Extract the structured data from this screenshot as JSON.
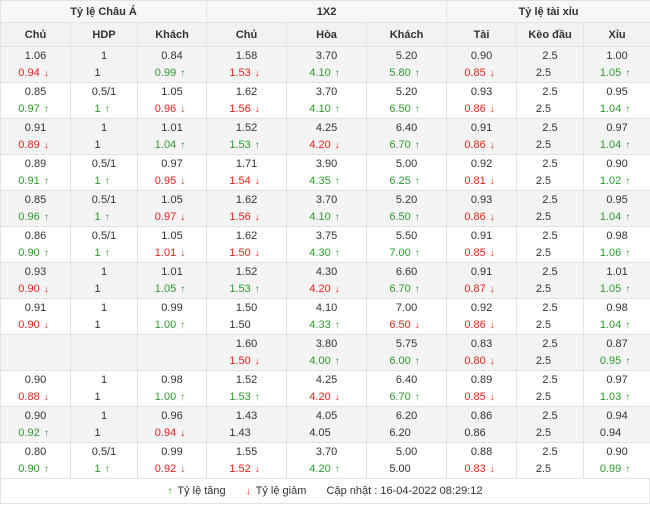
{
  "groups": [
    "Tỷ lệ Châu Á",
    "1X2",
    "Tỷ lệ tài xỉu"
  ],
  "columns": [
    "Chủ",
    "HDP",
    "Khách",
    "Chủ",
    "Hòa",
    "Khách",
    "Tài",
    "Kèo đầu",
    "Xỉu"
  ],
  "colors": {
    "up": "#2d9a2d",
    "down": "#e2231a",
    "header_bg": "#f2f2f2",
    "border": "#e3e3e3"
  },
  "rows": [
    {
      "cells": [
        {
          "top": "1.06",
          "bot": "0.94",
          "dir": "down"
        },
        {
          "top": "1",
          "bot": "1",
          "dir": ""
        },
        {
          "top": "0.84",
          "bot": "0.99",
          "dir": "up"
        },
        {
          "top": "1.58",
          "bot": "1.53",
          "dir": "down"
        },
        {
          "top": "3.70",
          "bot": "4.10",
          "dir": "up"
        },
        {
          "top": "5.20",
          "bot": "5.80",
          "dir": "up"
        },
        {
          "top": "0.90",
          "bot": "0.85",
          "dir": "down"
        },
        {
          "top": "2.5",
          "bot": "2.5",
          "dir": ""
        },
        {
          "top": "1.00",
          "bot": "1.05",
          "dir": "up"
        }
      ]
    },
    {
      "cells": [
        {
          "top": "0.85",
          "bot": "0.97",
          "dir": "up"
        },
        {
          "top": "0.5/1",
          "bot": "1",
          "dir": "up"
        },
        {
          "top": "1.05",
          "bot": "0.96",
          "dir": "down"
        },
        {
          "top": "1.62",
          "bot": "1.56",
          "dir": "down"
        },
        {
          "top": "3.70",
          "bot": "4.10",
          "dir": "up"
        },
        {
          "top": "5.20",
          "bot": "6.50",
          "dir": "up"
        },
        {
          "top": "0.93",
          "bot": "0.86",
          "dir": "down"
        },
        {
          "top": "2.5",
          "bot": "2.5",
          "dir": ""
        },
        {
          "top": "0.95",
          "bot": "1.04",
          "dir": "up"
        }
      ]
    },
    {
      "cells": [
        {
          "top": "0.91",
          "bot": "0.89",
          "dir": "down"
        },
        {
          "top": "1",
          "bot": "1",
          "dir": ""
        },
        {
          "top": "1.01",
          "bot": "1.04",
          "dir": "up"
        },
        {
          "top": "1.52",
          "bot": "1.53",
          "dir": "up"
        },
        {
          "top": "4.25",
          "bot": "4.20",
          "dir": "down"
        },
        {
          "top": "6.40",
          "bot": "6.70",
          "dir": "up"
        },
        {
          "top": "0.91",
          "bot": "0.86",
          "dir": "down"
        },
        {
          "top": "2.5",
          "bot": "2.5",
          "dir": ""
        },
        {
          "top": "0.97",
          "bot": "1.04",
          "dir": "up"
        }
      ]
    },
    {
      "cells": [
        {
          "top": "0.89",
          "bot": "0.91",
          "dir": "up"
        },
        {
          "top": "0.5/1",
          "bot": "1",
          "dir": "up"
        },
        {
          "top": "0.97",
          "bot": "0.95",
          "dir": "down"
        },
        {
          "top": "1.71",
          "bot": "1.54",
          "dir": "down"
        },
        {
          "top": "3.90",
          "bot": "4.35",
          "dir": "up"
        },
        {
          "top": "5.00",
          "bot": "6.25",
          "dir": "up"
        },
        {
          "top": "0.92",
          "bot": "0.81",
          "dir": "down"
        },
        {
          "top": "2.5",
          "bot": "2.5",
          "dir": ""
        },
        {
          "top": "0.90",
          "bot": "1.02",
          "dir": "up"
        }
      ]
    },
    {
      "cells": [
        {
          "top": "0.85",
          "bot": "0.96",
          "dir": "up"
        },
        {
          "top": "0.5/1",
          "bot": "1",
          "dir": "up"
        },
        {
          "top": "1.05",
          "bot": "0.97",
          "dir": "down"
        },
        {
          "top": "1.62",
          "bot": "1.56",
          "dir": "down"
        },
        {
          "top": "3.70",
          "bot": "4.10",
          "dir": "up"
        },
        {
          "top": "5.20",
          "bot": "6.50",
          "dir": "up"
        },
        {
          "top": "0.93",
          "bot": "0.86",
          "dir": "down"
        },
        {
          "top": "2.5",
          "bot": "2.5",
          "dir": ""
        },
        {
          "top": "0.95",
          "bot": "1.04",
          "dir": "up"
        }
      ]
    },
    {
      "cells": [
        {
          "top": "0.86",
          "bot": "0.90",
          "dir": "up"
        },
        {
          "top": "0.5/1",
          "bot": "1",
          "dir": "up"
        },
        {
          "top": "1.05",
          "bot": "1.01",
          "dir": "down"
        },
        {
          "top": "1.62",
          "bot": "1.50",
          "dir": "down"
        },
        {
          "top": "3.75",
          "bot": "4.30",
          "dir": "up"
        },
        {
          "top": "5.50",
          "bot": "7.00",
          "dir": "up"
        },
        {
          "top": "0.91",
          "bot": "0.85",
          "dir": "down"
        },
        {
          "top": "2.5",
          "bot": "2.5",
          "dir": ""
        },
        {
          "top": "0.98",
          "bot": "1.06",
          "dir": "up"
        }
      ]
    },
    {
      "cells": [
        {
          "top": "0.93",
          "bot": "0.90",
          "dir": "down"
        },
        {
          "top": "1",
          "bot": "1",
          "dir": ""
        },
        {
          "top": "1.01",
          "bot": "1.05",
          "dir": "up"
        },
        {
          "top": "1.52",
          "bot": "1.53",
          "dir": "up"
        },
        {
          "top": "4.30",
          "bot": "4.20",
          "dir": "down"
        },
        {
          "top": "6.60",
          "bot": "6.70",
          "dir": "up"
        },
        {
          "top": "0.91",
          "bot": "0.87",
          "dir": "down"
        },
        {
          "top": "2.5",
          "bot": "2.5",
          "dir": ""
        },
        {
          "top": "1.01",
          "bot": "1.05",
          "dir": "up"
        }
      ]
    },
    {
      "cells": [
        {
          "top": "0.91",
          "bot": "0.90",
          "dir": "down"
        },
        {
          "top": "1",
          "bot": "1",
          "dir": ""
        },
        {
          "top": "0.99",
          "bot": "1.00",
          "dir": "up"
        },
        {
          "top": "1.50",
          "bot": "1.50",
          "dir": ""
        },
        {
          "top": "4.10",
          "bot": "4.33",
          "dir": "up"
        },
        {
          "top": "7.00",
          "bot": "6.50",
          "dir": "down"
        },
        {
          "top": "0.92",
          "bot": "0.86",
          "dir": "down"
        },
        {
          "top": "2.5",
          "bot": "2.5",
          "dir": ""
        },
        {
          "top": "0.98",
          "bot": "1.04",
          "dir": "up"
        }
      ]
    },
    {
      "cells": [
        {
          "top": "",
          "bot": "",
          "dir": ""
        },
        {
          "top": "",
          "bot": "",
          "dir": ""
        },
        {
          "top": "",
          "bot": "",
          "dir": ""
        },
        {
          "top": "1.60",
          "bot": "1.50",
          "dir": "down"
        },
        {
          "top": "3.80",
          "bot": "4.00",
          "dir": "up"
        },
        {
          "top": "5.75",
          "bot": "6.00",
          "dir": "up"
        },
        {
          "top": "0.83",
          "bot": "0.80",
          "dir": "down"
        },
        {
          "top": "2.5",
          "bot": "2.5",
          "dir": ""
        },
        {
          "top": "0.87",
          "bot": "0.95",
          "dir": "up"
        }
      ]
    },
    {
      "cells": [
        {
          "top": "0.90",
          "bot": "0.88",
          "dir": "down"
        },
        {
          "top": "1",
          "bot": "1",
          "dir": ""
        },
        {
          "top": "0.98",
          "bot": "1.00",
          "dir": "up"
        },
        {
          "top": "1.52",
          "bot": "1.53",
          "dir": "up"
        },
        {
          "top": "4.25",
          "bot": "4.20",
          "dir": "down"
        },
        {
          "top": "6.40",
          "bot": "6.70",
          "dir": "up"
        },
        {
          "top": "0.89",
          "bot": "0.85",
          "dir": "down"
        },
        {
          "top": "2.5",
          "bot": "2.5",
          "dir": ""
        },
        {
          "top": "0.97",
          "bot": "1.03",
          "dir": "up"
        }
      ]
    },
    {
      "cells": [
        {
          "top": "0.90",
          "bot": "0.92",
          "dir": "up"
        },
        {
          "top": "1",
          "bot": "1",
          "dir": ""
        },
        {
          "top": "0.96",
          "bot": "0.94",
          "dir": "down"
        },
        {
          "top": "1.43",
          "bot": "1.43",
          "dir": ""
        },
        {
          "top": "4.05",
          "bot": "4.05",
          "dir": ""
        },
        {
          "top": "6.20",
          "bot": "6.20",
          "dir": ""
        },
        {
          "top": "0.86",
          "bot": "0.86",
          "dir": ""
        },
        {
          "top": "2.5",
          "bot": "2.5",
          "dir": ""
        },
        {
          "top": "0.94",
          "bot": "0.94",
          "dir": ""
        }
      ]
    },
    {
      "cells": [
        {
          "top": "0.80",
          "bot": "0.90",
          "dir": "up"
        },
        {
          "top": "0.5/1",
          "bot": "1",
          "dir": "up"
        },
        {
          "top": "0.99",
          "bot": "0.92",
          "dir": "down"
        },
        {
          "top": "1.55",
          "bot": "1.52",
          "dir": "down"
        },
        {
          "top": "3.70",
          "bot": "4.20",
          "dir": "up"
        },
        {
          "top": "5.00",
          "bot": "5.00",
          "dir": ""
        },
        {
          "top": "0.88",
          "bot": "0.83",
          "dir": "down"
        },
        {
          "top": "2.5",
          "bot": "2.5",
          "dir": ""
        },
        {
          "top": "0.90",
          "bot": "0.99",
          "dir": "up"
        }
      ]
    }
  ],
  "footer": {
    "up_label": "Tỷ lệ tăng",
    "down_label": "Tỷ lệ giảm",
    "updated_label": "Cập nhật :",
    "updated_value": "16-04-2022 08:29:12"
  }
}
